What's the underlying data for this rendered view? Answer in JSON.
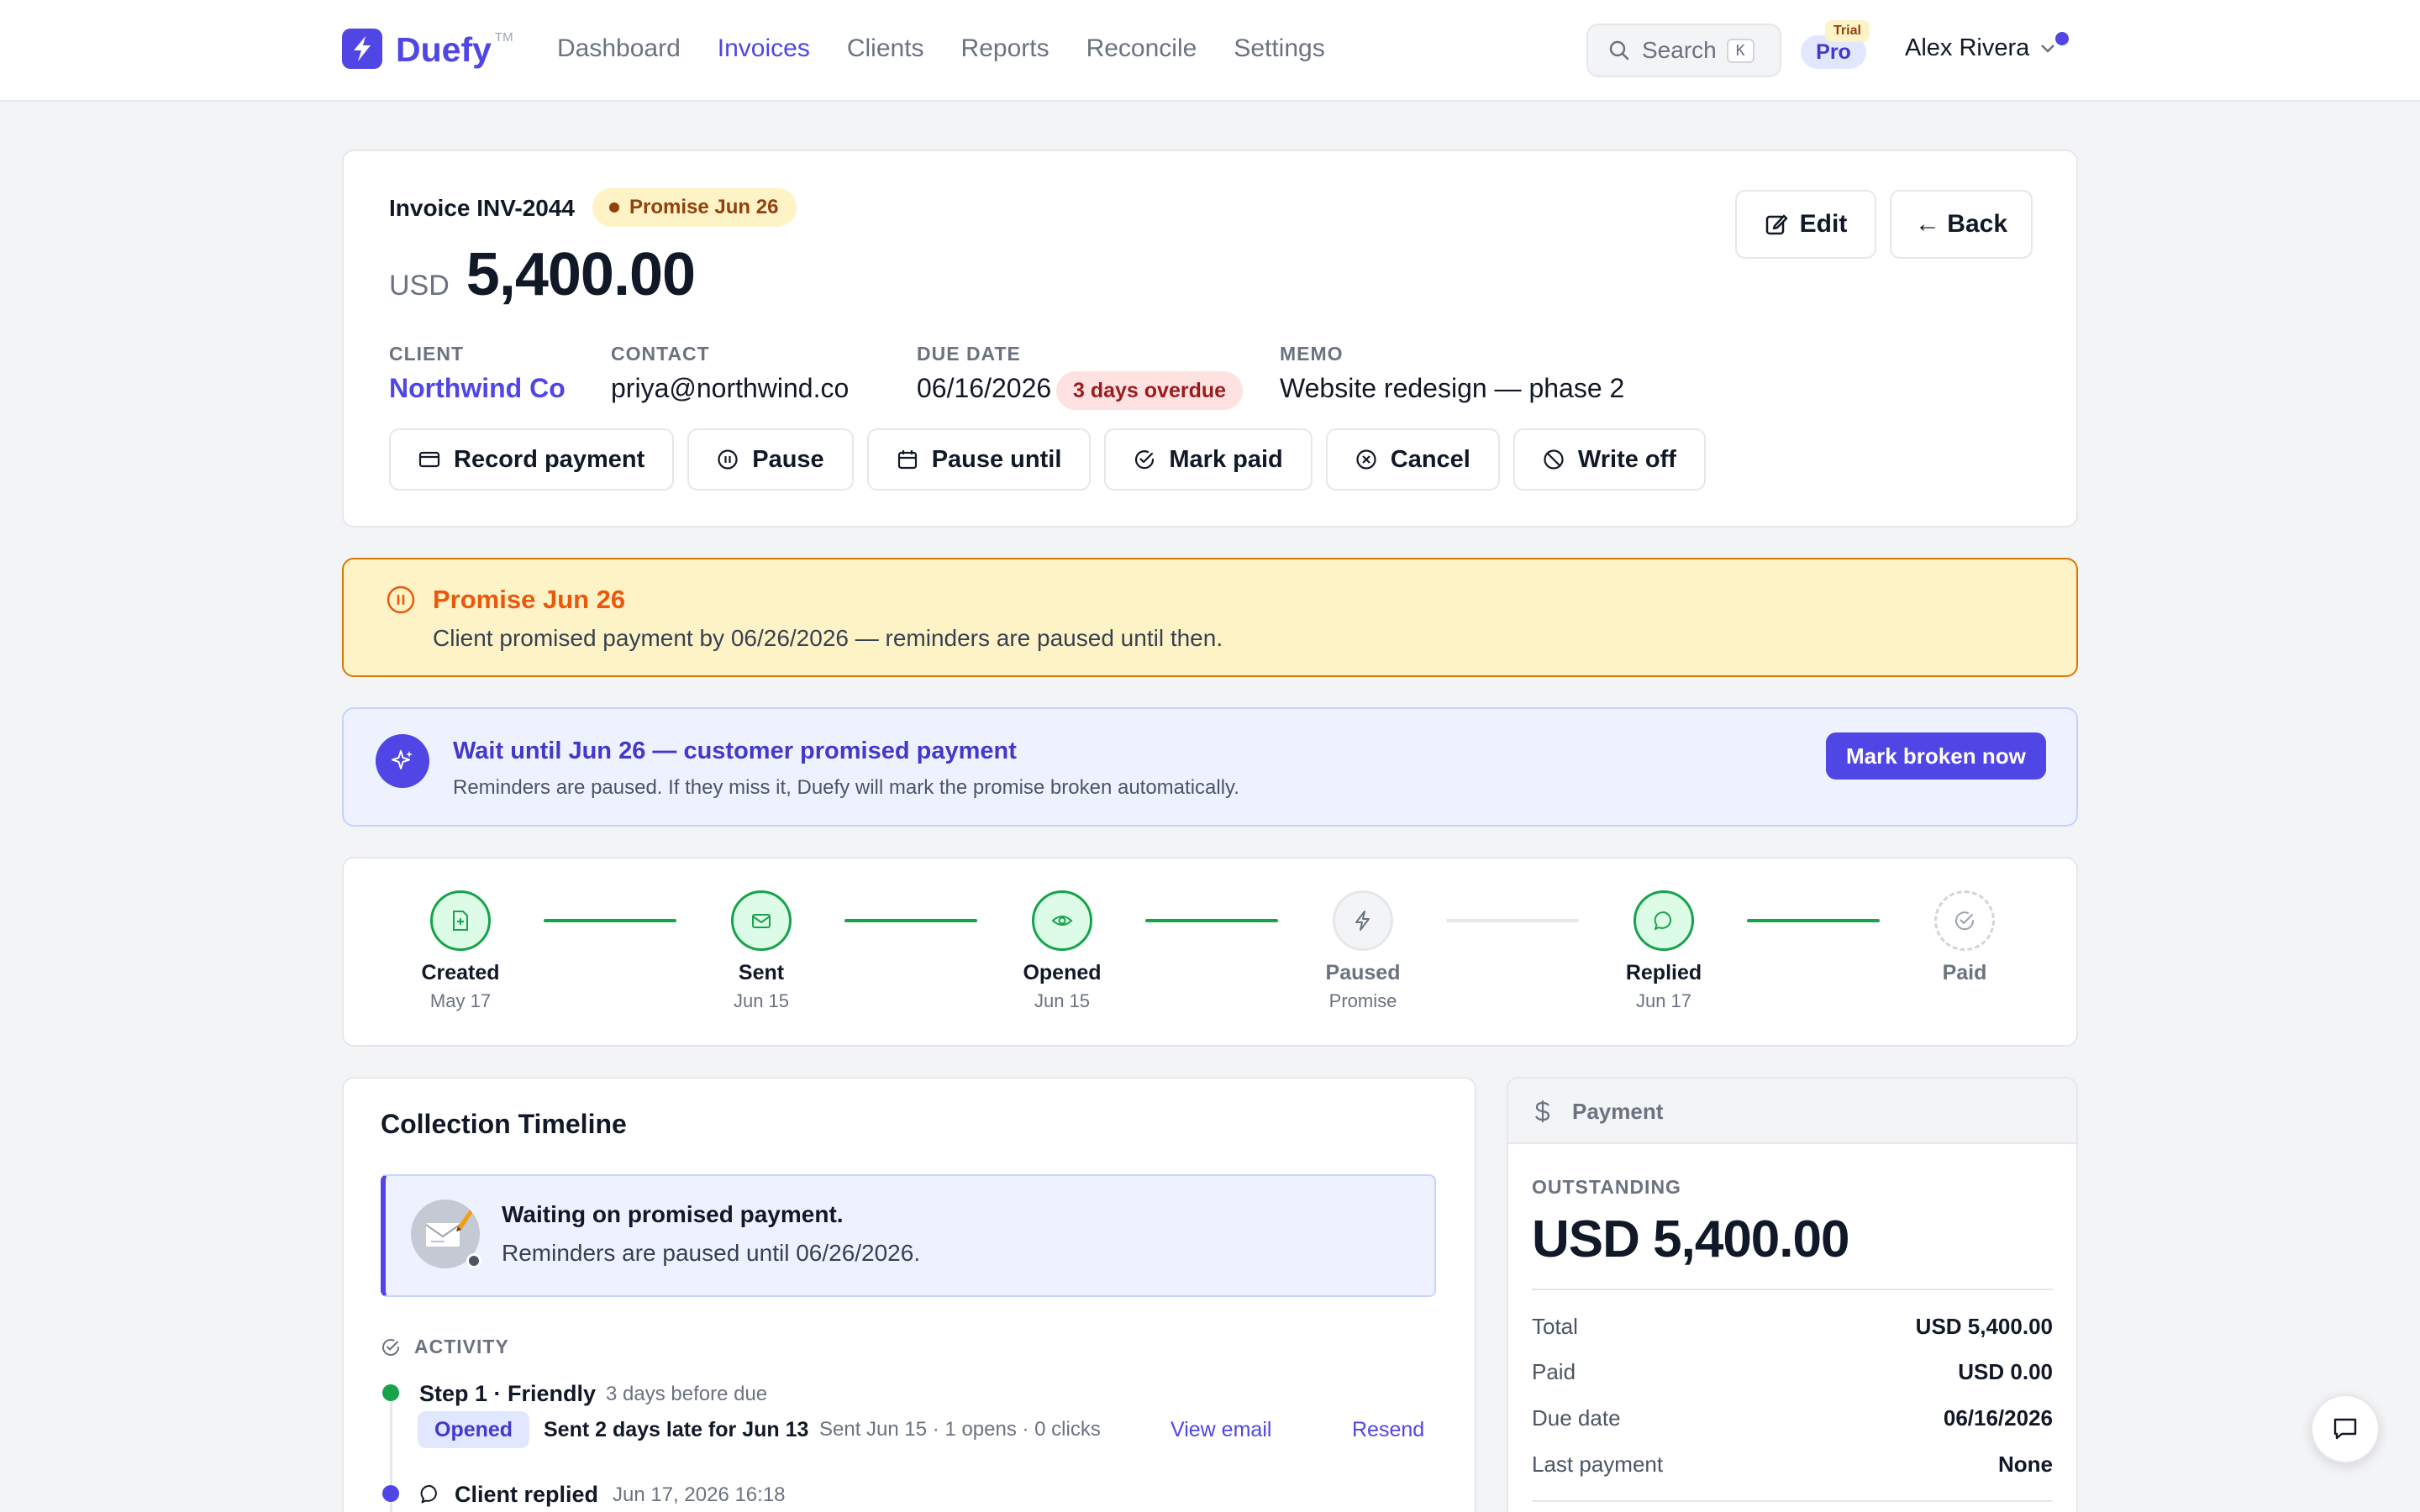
{
  "brand": {
    "name": "Duefy",
    "tm": "TM"
  },
  "nav": {
    "items": [
      {
        "label": "Dashboard"
      },
      {
        "label": "Invoices"
      },
      {
        "label": "Clients"
      },
      {
        "label": "Reports"
      },
      {
        "label": "Reconcile"
      },
      {
        "label": "Settings"
      }
    ],
    "active": "Invoices"
  },
  "search": {
    "label": "Search",
    "shortcut": "K"
  },
  "plan": {
    "label": "Pro",
    "badge": "Trial"
  },
  "user": {
    "name": "Alex Rivera"
  },
  "invoice": {
    "title": "Invoice INV-2044",
    "status_pill": "Promise Jun 26",
    "currency": "USD",
    "amount": "5,400.00",
    "edit_label": "Edit",
    "back_label": "← Back",
    "fields": {
      "client_label": "CLIENT",
      "client": "Northwind Co",
      "contact_label": "CONTACT",
      "contact": "priya@northwind.co",
      "due_label": "DUE DATE",
      "due": "06/16/2026",
      "overdue": "3 days overdue",
      "memo_label": "MEMO",
      "memo": "Website redesign — phase 2"
    },
    "actions": [
      {
        "label": "Record payment",
        "icon": "credit-card-icon"
      },
      {
        "label": "Pause",
        "icon": "pause-circle-icon"
      },
      {
        "label": "Pause until",
        "icon": "calendar-icon"
      },
      {
        "label": "Mark paid",
        "icon": "check-circle-icon"
      },
      {
        "label": "Cancel",
        "icon": "x-circle-icon"
      },
      {
        "label": "Write off",
        "icon": "ban-icon"
      }
    ]
  },
  "promise_banner": {
    "title": "Promise Jun 26",
    "text": "Client promised payment by 06/26/2026 — reminders are paused until then."
  },
  "suggestion": {
    "title": "Wait until Jun 26 — customer promised payment",
    "text": "Reminders are paused. If they miss it, Duefy will mark the promise broken automatically.",
    "button": "Mark broken now"
  },
  "stepper": [
    {
      "label": "Created",
      "sub": "May 17",
      "state": "done",
      "icon": "file-plus-icon"
    },
    {
      "label": "Sent",
      "sub": "Jun 15",
      "state": "done",
      "icon": "mail-icon"
    },
    {
      "label": "Opened",
      "sub": "Jun 15",
      "state": "done",
      "icon": "eye-icon"
    },
    {
      "label": "Paused",
      "sub": "Promise",
      "state": "paused",
      "icon": "bolt-icon"
    },
    {
      "label": "Replied",
      "sub": "Jun 17",
      "state": "done",
      "icon": "chat-icon"
    },
    {
      "label": "Paid",
      "sub": "",
      "state": "pending",
      "icon": "check-circle-icon"
    }
  ],
  "timeline": {
    "title": "Collection Timeline",
    "status_title": "Waiting on promised payment.",
    "status_text": "Reminders are paused until 06/26/2026.",
    "activity_label": "ACTIVITY",
    "items": [
      {
        "title": "Step 1 · Friendly",
        "meta": "3 days before due",
        "badge": "Opened",
        "note": "Sent 2 days late for Jun 13",
        "detail": "Sent Jun 15 · 1 opens · 0 clicks",
        "link1": "View email",
        "link2": "Resend"
      },
      {
        "title": "Client replied",
        "meta": "Jun 17, 2026 16:18"
      }
    ]
  },
  "payment": {
    "header": "Payment",
    "outstanding_label": "OUTSTANDING",
    "outstanding": "USD 5,400.00",
    "rows": [
      {
        "k": "Total",
        "v": "USD 5,400.00"
      },
      {
        "k": "Paid",
        "v": "USD 0.00"
      },
      {
        "k": "Due date",
        "v": "06/16/2026"
      },
      {
        "k": "Last payment",
        "v": "None"
      }
    ]
  },
  "colors": {
    "accent": "#4f46e5",
    "success": "#16a34a",
    "warning": "#d97706",
    "danger": "#991b1b"
  }
}
